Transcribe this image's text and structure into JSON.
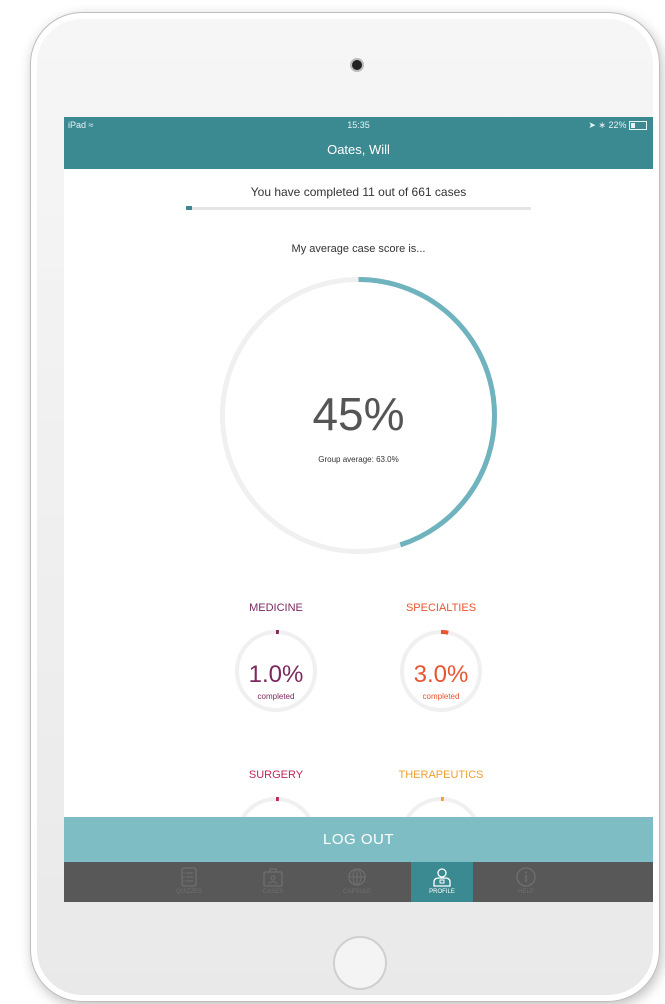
{
  "status_bar": {
    "device": "iPad",
    "time": "15:35",
    "battery": "22%"
  },
  "nav": {
    "title": "Oates, Will"
  },
  "progress": {
    "text": "You have completed 11 out of 661 cases",
    "completed": 11,
    "total": 661
  },
  "average": {
    "label": "My average case score is...",
    "value_text": "45%",
    "value": 45,
    "group_average": "Group average: 63.0%",
    "ring_color": "#6fb3be"
  },
  "categories": [
    {
      "name": "MEDICINE",
      "value_text": "1.0%",
      "value": 1.0,
      "sub": "completed",
      "color": "#7b2a5e"
    },
    {
      "name": "SPECIALTIES",
      "value_text": "3.0%",
      "value": 3.0,
      "sub": "completed",
      "color": "#e8552f"
    },
    {
      "name": "SURGERY",
      "value": 1.0,
      "color": "#c0265a"
    },
    {
      "name": "THERAPEUTICS",
      "value": 1.0,
      "color": "#f0a030"
    }
  ],
  "logout": {
    "label": "LOG OUT"
  },
  "tabs": [
    {
      "label": "QUIZZES",
      "icon": "quiz-icon",
      "active": false
    },
    {
      "label": "CASES",
      "icon": "cases-icon",
      "active": false
    },
    {
      "label": "CAPSULE",
      "icon": "capsule-icon",
      "active": false
    },
    {
      "label": "PROFILE",
      "icon": "profile-icon",
      "active": true
    },
    {
      "label": "HELP",
      "icon": "help-icon",
      "active": false
    }
  ],
  "colors": {
    "header": "#3b8a92",
    "logout": "#7fbdc4",
    "tabbar": "#585858"
  }
}
